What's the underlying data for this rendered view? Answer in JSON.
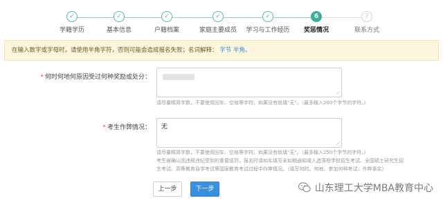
{
  "stepper": {
    "steps": [
      {
        "label": "学籍学历",
        "state": "done"
      },
      {
        "label": "基本信息",
        "state": "done"
      },
      {
        "label": "户籍档案",
        "state": "done"
      },
      {
        "label": "家庭主要成员",
        "state": "done"
      },
      {
        "label": "学习与工作经历",
        "state": "done"
      },
      {
        "label": "奖惩情况",
        "state": "current",
        "number": "6"
      },
      {
        "label": "联系方式",
        "state": "pending",
        "number": "7"
      }
    ],
    "check_glyph": "✓"
  },
  "notice": {
    "text": "在输入数字或字母时，请使用半角字符，否则可能会造成报名失败；名词解释：",
    "link": "字节 半角。"
  },
  "form": {
    "awards": {
      "required_mark": "*",
      "label": "何时何地何原因受过何种奖励或处分：",
      "value": "",
      "hint": "请尽量精简字数，不要使用回车、空格等字符，如果没有就填\"无\"。（最多输入200个字节的字符。）"
    },
    "cheating": {
      "required_mark": "*",
      "label": "考生作弊情况：",
      "value": "无",
      "hint_lines": [
        "请尽量精简字数，不要使用回车、空格等字符，如果没有就填\"无\"。（最多输入250个字节的字符。）",
        "考生被确认因违规违纪受到的重要惩罚，报名时请如实填写未如期通知或入选落榜学校招生考试、全国硕士研究生招",
        "生考试、高等教育自学考试等国家教育考试过程中作弊情况。（填写何时、何地、参加何种考试、作弊事实）"
      ]
    }
  },
  "buttons": {
    "prev": "上一步",
    "next": "下一步"
  },
  "watermark": {
    "text": "山东理工大学MBA教育中心"
  },
  "colors": {
    "accent": "#3cae9d",
    "primary_button": "#3b8fe0",
    "required": "#e0463c",
    "notice_bg": "#fdf6df"
  }
}
